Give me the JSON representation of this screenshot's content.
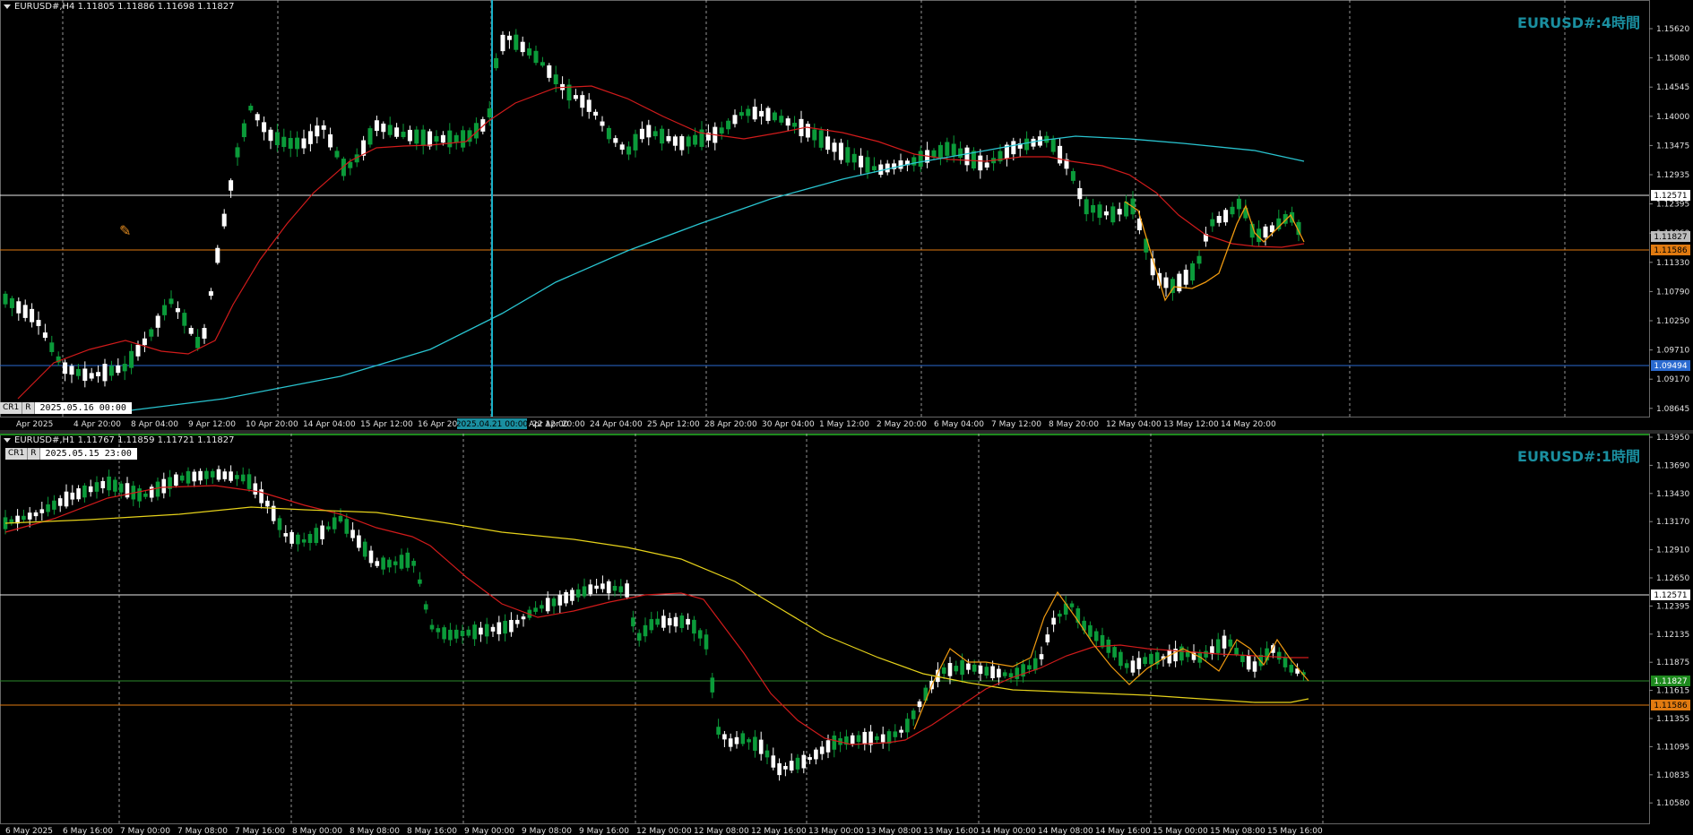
{
  "pane_top": {
    "header": "EURUSD#,H4  1.11805 1.11886 1.11698 1.11827",
    "watermark": "EURUSD#:4時間",
    "crosshair": {
      "buttons": [
        "CR1",
        "R"
      ],
      "datetime": "2025.05.16 00:00"
    },
    "vline_tag": "2025.04.21 00:00",
    "price_labels": [
      "1.15620",
      "1.15080",
      "1.14545",
      "1.14000",
      "1.13475",
      "1.12935",
      "1.12395",
      "1.11860",
      "1.11330",
      "1.10790",
      "1.10250",
      "1.09710",
      "1.09170",
      "1.08645"
    ],
    "tags": {
      "white": "1.12571",
      "gray": "1.11827",
      "orange": "1.11586",
      "blue": "1.09494"
    },
    "time_labels": [
      "Apr 2025",
      "4 Apr 20:00",
      "8 Apr 04:00",
      "9 Apr 12:00",
      "10 Apr 20:00",
      "14 Apr 04:00",
      "15 Apr 12:00",
      "16 Apr 20:00",
      "",
      "22 Apr 20:00",
      "24 Apr 04:00",
      "25 Apr 12:00",
      "28 Apr 20:00",
      "30 Apr 04:00",
      "1 May 12:00",
      "2 May 20:00",
      "6 May 04:00",
      "7 May 12:00",
      "8 May 20:00",
      "12 May 04:00",
      "13 May 12:00",
      "14 May 20:00"
    ],
    "time_label_after_tag": "Apr 12:00",
    "colors": {
      "bull": "#0b9b3a",
      "bear": "#ffffff",
      "ma_red": "#d11b1b",
      "ma_cyan": "#29c4d0",
      "zigzag": "#f09a10",
      "watermark": "#1a8fa0"
    }
  },
  "pane_bottom": {
    "header": "EURUSD#,H1  1.11767 1.11859 1.11721 1.11827",
    "watermark": "EURUSD#:1時間",
    "crosshair": {
      "buttons": [
        "CR1",
        "R"
      ],
      "datetime": "2025.05.15 23:00"
    },
    "price_labels": [
      "1.13950",
      "1.13690",
      "1.13430",
      "1.13170",
      "1.12910",
      "1.12650",
      "1.12395",
      "1.12135",
      "1.11875",
      "1.11615",
      "1.11355",
      "1.11095",
      "1.10835",
      "1.10580"
    ],
    "tags": {
      "white": "1.12571",
      "green": "1.11827",
      "orange": "1.11586"
    },
    "time_labels": [
      "6 May 2025",
      "6 May 16:00",
      "7 May 00:00",
      "7 May 08:00",
      "7 May 16:00",
      "8 May 00:00",
      "8 May 08:00",
      "8 May 16:00",
      "9 May 00:00",
      "9 May 08:00",
      "9 May 16:00",
      "12 May 00:00",
      "12 May 08:00",
      "12 May 16:00",
      "13 May 00:00",
      "13 May 08:00",
      "13 May 16:00",
      "14 May 00:00",
      "14 May 08:00",
      "14 May 16:00",
      "15 May 00:00",
      "15 May 08:00",
      "15 May 16:00"
    ],
    "colors": {
      "ma_red": "#d11b1b",
      "ma_yellow": "#e6d21a",
      "green_line": "#2b8a2b"
    }
  }
}
